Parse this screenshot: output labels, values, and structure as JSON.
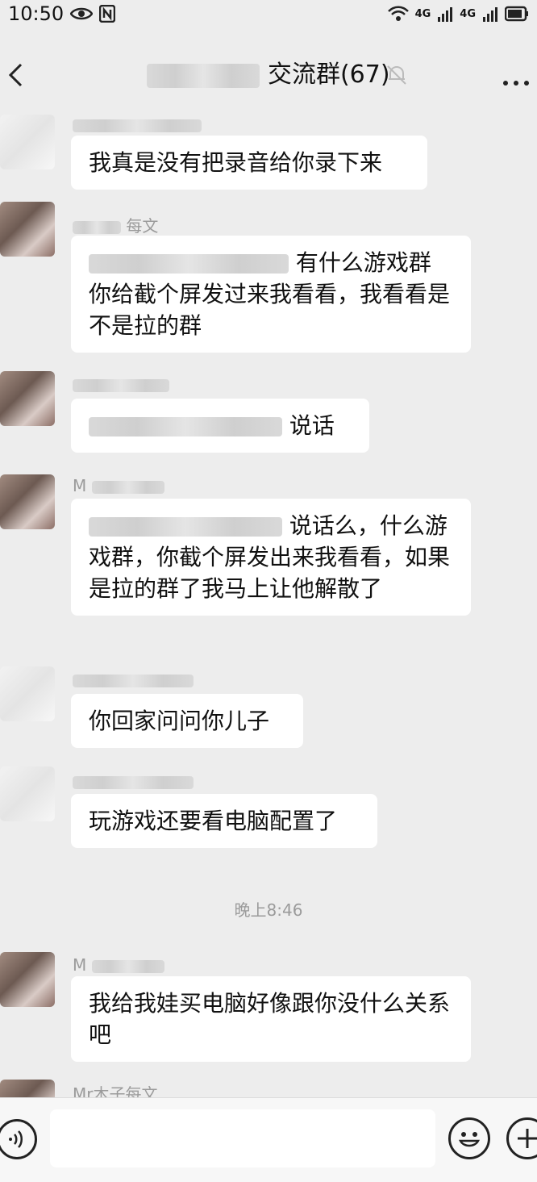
{
  "status": {
    "time": "10:50",
    "eye_icon": "eye-icon",
    "nfc_icon": "nfc-icon",
    "sig1": "4G",
    "sig2": "4G"
  },
  "header": {
    "title": "交流群(67)"
  },
  "messages": [
    {
      "text": "我真是没有把录音给你录下来"
    },
    {
      "name": "每文",
      "text": "有什么游戏群你给截个屏发过来我看看，我看看是不是拉的群"
    },
    {
      "text": "说话"
    },
    {
      "name": "M",
      "text": "说话么，什么游戏群，你截个屏发出来我看看，如果是拉的群了我马上让他解散了"
    },
    {
      "text": "你回家问问你儿子"
    },
    {
      "text": "玩游戏还要看电脑配置了"
    },
    {
      "timestamp": "晚上8:46"
    },
    {
      "name": "M",
      "text": "我给我娃买电脑好像跟你没什么关系吧"
    },
    {
      "name": "Mr木子每文"
    }
  ],
  "colors": {
    "background": "#ededed",
    "bubble": "#ffffff",
    "name": "#9b9b9b"
  }
}
